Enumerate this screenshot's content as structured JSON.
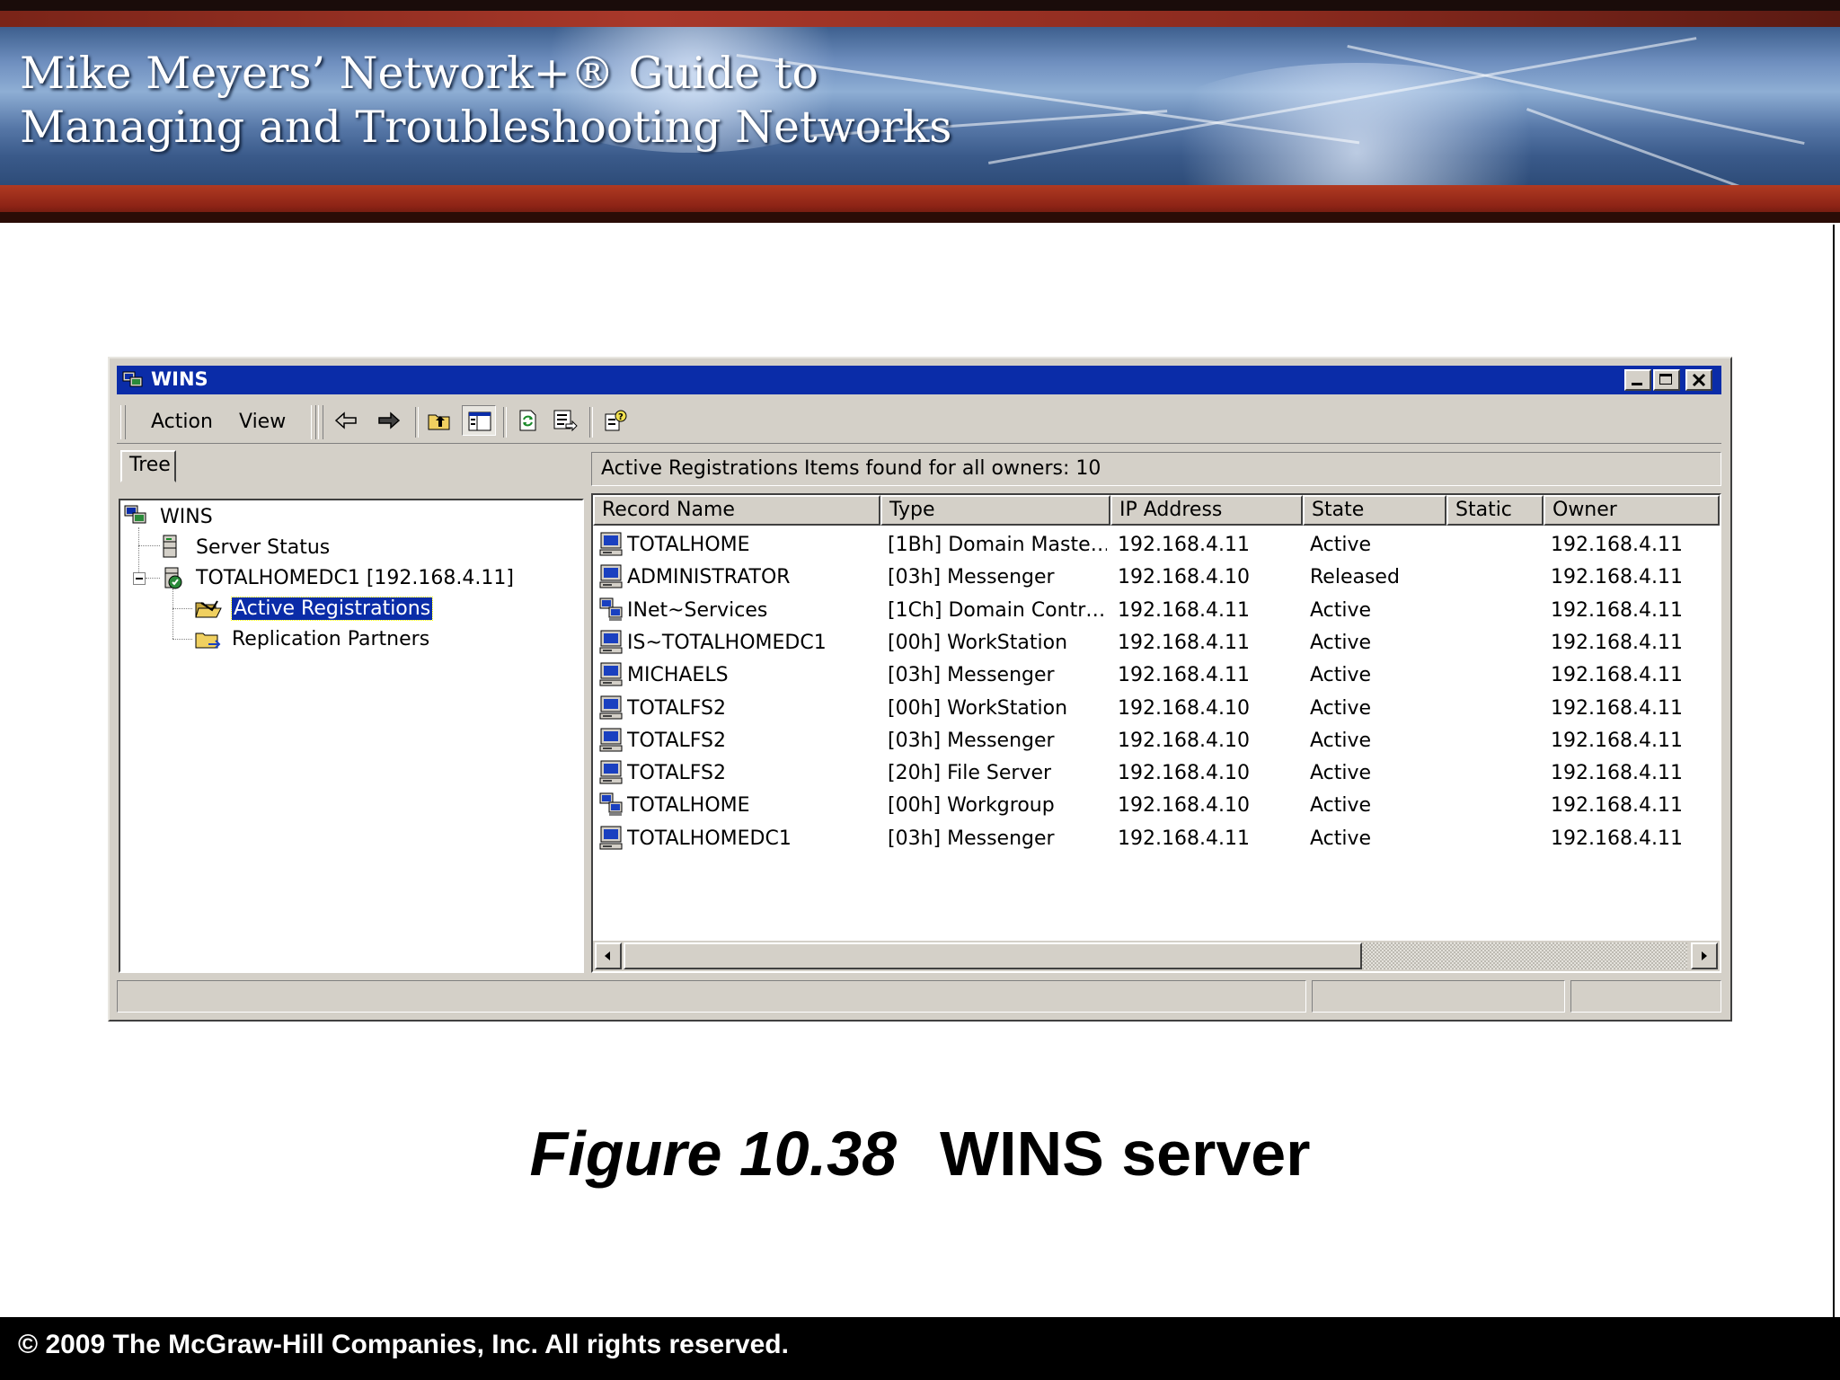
{
  "slide": {
    "title_line1": "Mike Meyers’ Network+® Guide to",
    "title_line2": "Managing and Troubleshooting Networks",
    "caption_figure": "Figure 10.38",
    "caption_text": "WINS server",
    "footer": "© 2009 The McGraw-Hill Companies, Inc. All rights reserved."
  },
  "window": {
    "title": "WINS",
    "controls": [
      "minimize-icon",
      "maximize-icon",
      "close-icon"
    ]
  },
  "menu": {
    "action": "Action",
    "view": "View"
  },
  "toolbar": {
    "icons": [
      "back-arrow-icon",
      "forward-arrow-icon",
      "up-folder-icon",
      "show-hide-tree-icon",
      "refresh-icon",
      "export-list-icon",
      "help-icon"
    ]
  },
  "tree": {
    "tab_label": "Tree",
    "root": "WINS",
    "items": [
      {
        "label": "Server Status",
        "icon": "server-icon"
      },
      {
        "label": "TOTALHOMEDC1 [192.168.4.11]",
        "icon": "wins-server-icon"
      },
      {
        "label": "Active Registrations",
        "icon": "folder-open-icon",
        "selected": true
      },
      {
        "label": "Replication Partners",
        "icon": "folder-partners-icon"
      }
    ]
  },
  "list": {
    "header_title": "Active Registrations",
    "header_count": "Items found for all owners: 10",
    "columns": [
      "Record Name",
      "Type",
      "IP Address",
      "State",
      "Static",
      "Owner"
    ],
    "rows": [
      {
        "icon": "computer-icon",
        "name": "TOTALHOME",
        "type": "[1Bh] Domain Maste…",
        "ip": "192.168.4.11",
        "state": "Active",
        "static": "",
        "owner": "192.168.4.11"
      },
      {
        "icon": "computer-icon",
        "name": "ADMINISTRATOR",
        "type": "[03h] Messenger",
        "ip": "192.168.4.10",
        "state": "Released",
        "static": "",
        "owner": "192.168.4.11"
      },
      {
        "icon": "computer-group-icon",
        "name": "INet~Services",
        "type": "[1Ch] Domain Contr…",
        "ip": "192.168.4.11",
        "state": "Active",
        "static": "",
        "owner": "192.168.4.11"
      },
      {
        "icon": "computer-icon",
        "name": "IS~TOTALHOMEDC1",
        "type": "[00h] WorkStation",
        "ip": "192.168.4.11",
        "state": "Active",
        "static": "",
        "owner": "192.168.4.11"
      },
      {
        "icon": "computer-icon",
        "name": "MICHAELS",
        "type": "[03h] Messenger",
        "ip": "192.168.4.11",
        "state": "Active",
        "static": "",
        "owner": "192.168.4.11"
      },
      {
        "icon": "computer-icon",
        "name": "TOTALFS2",
        "type": "[00h] WorkStation",
        "ip": "192.168.4.10",
        "state": "Active",
        "static": "",
        "owner": "192.168.4.11"
      },
      {
        "icon": "computer-icon",
        "name": "TOTALFS2",
        "type": "[03h] Messenger",
        "ip": "192.168.4.10",
        "state": "Active",
        "static": "",
        "owner": "192.168.4.11"
      },
      {
        "icon": "computer-icon",
        "name": "TOTALFS2",
        "type": "[20h] File Server",
        "ip": "192.168.4.10",
        "state": "Active",
        "static": "",
        "owner": "192.168.4.11"
      },
      {
        "icon": "computer-group-icon",
        "name": "TOTALHOME",
        "type": "[00h] Workgroup",
        "ip": "192.168.4.10",
        "state": "Active",
        "static": "",
        "owner": "192.168.4.11"
      },
      {
        "icon": "computer-icon",
        "name": "TOTALHOMEDC1",
        "type": "[03h] Messenger",
        "ip": "192.168.4.11",
        "state": "Active",
        "static": "",
        "owner": "192.168.4.11"
      }
    ]
  },
  "colors": {
    "titlebar": "#0a2ca8",
    "selection": "#0a2ca8",
    "window_face": "#d4d0c8"
  }
}
